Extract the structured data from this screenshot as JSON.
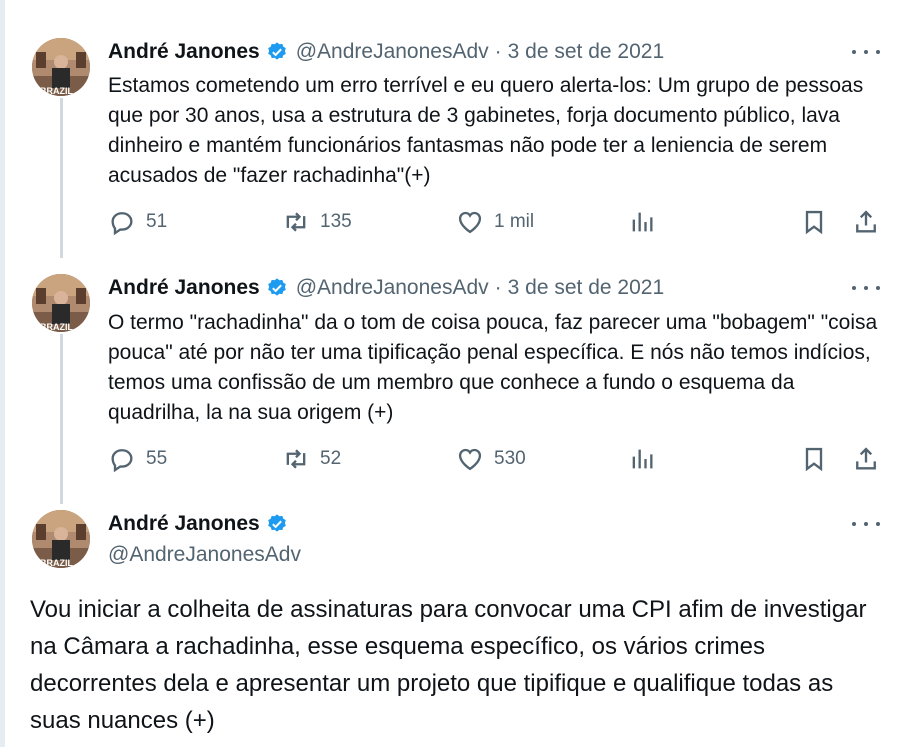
{
  "tweets": [
    {
      "name": "André Janones",
      "handle": "@AndreJanonesAdv",
      "separator": "·",
      "date": "3 de set de 2021",
      "text": "Estamos cometendo um erro terrível e eu quero alerta-los: Um grupo de pessoas que por 30 anos, usa a estrutura de 3 gabinetes, forja documento público, lava dinheiro e mantém funcionários fantasmas não pode ter a leniencia de serem acusados de \"fazer rachadinha\"(+)",
      "replies": "51",
      "retweets": "135",
      "likes": "1 mil"
    },
    {
      "name": "André Janones",
      "handle": "@AndreJanonesAdv",
      "separator": "·",
      "date": "3 de set de 2021",
      "text": "O termo \"rachadinha\" da o tom de coisa pouca, faz parecer uma \"bobagem\" \"coisa pouca\" até por não ter uma tipificação penal específica. E nós não temos indícios, temos uma confissão de um membro que conhece a fundo o esquema da quadrilha, la na sua origem (+)",
      "replies": "55",
      "retweets": "52",
      "likes": "530"
    },
    {
      "name": "André Janones",
      "handle": "@AndreJanonesAdv",
      "text": "Vou iniciar a colheita de assinaturas para convocar uma CPI afim de investigar na Câmara a rachadinha, esse esquema específico, os vários crimes decorrentes dela e apresentar um projeto que tipifique e qualifique todas as suas nuances (+)"
    }
  ],
  "avatar_caption": "BRAZIL",
  "colors": {
    "verified": "#1d9bf0",
    "secondary_text": "#536471",
    "thread_line": "#cfd9de"
  }
}
